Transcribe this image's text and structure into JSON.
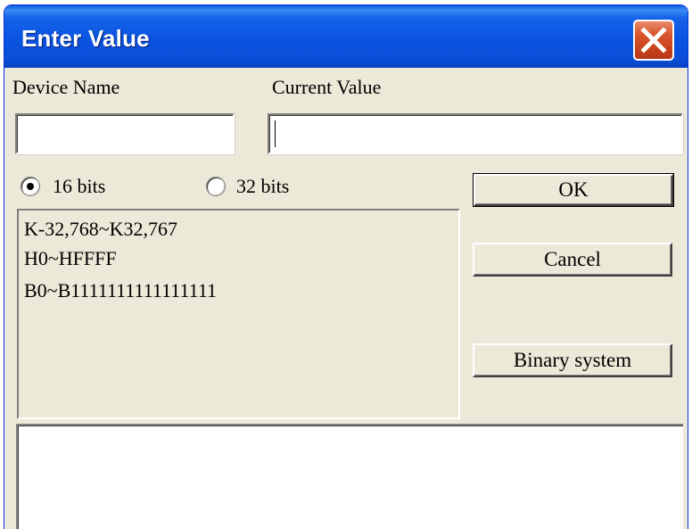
{
  "window": {
    "title": "Enter Value"
  },
  "labels": {
    "device_name": "Device Name",
    "current_value": "Current Value"
  },
  "fields": {
    "device_name_value": "",
    "current_value_value": ""
  },
  "radios": {
    "bits16_label": "16 bits",
    "bits32_label": "32 bits",
    "selected": "16 bits"
  },
  "ranges": {
    "decimal": "K-32,768~K32,767",
    "hex": "H0~HFFFF",
    "binary": "B0~B1111111111111111"
  },
  "buttons": {
    "ok_label": "OK",
    "cancel_label": "Cancel",
    "binary_label": "Binary system"
  },
  "icons": {
    "close": "close-icon"
  },
  "colors": {
    "titlebar": "#0a53e0",
    "window_bg": "#ece9d8",
    "close_button": "#c9421b"
  }
}
